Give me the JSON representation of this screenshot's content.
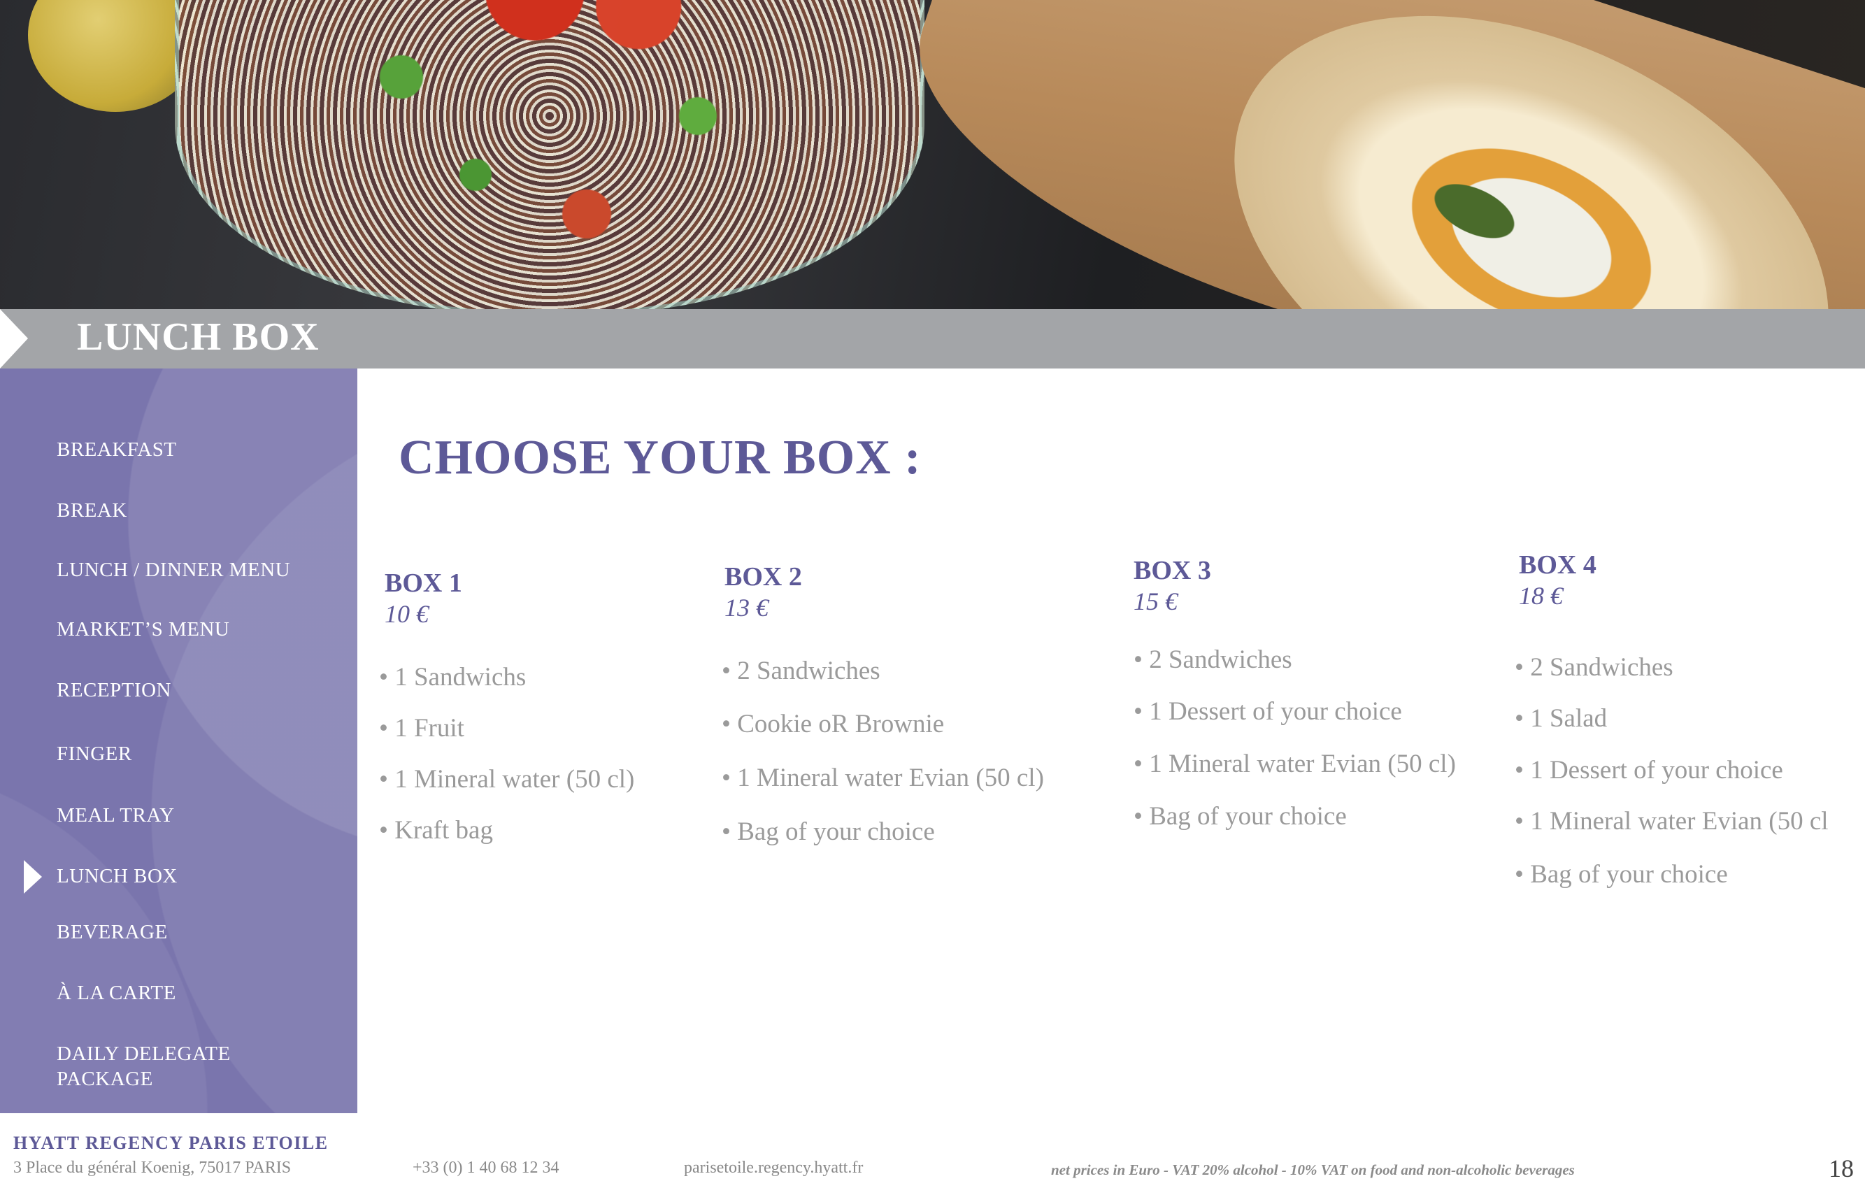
{
  "header": {
    "title": "LUNCH BOX"
  },
  "sidebar": {
    "items": [
      {
        "label": "BREAKFAST"
      },
      {
        "label": "BREAK"
      },
      {
        "label": "LUNCH / DINNER MENU"
      },
      {
        "label": "MARKET’S MENU"
      },
      {
        "label": "RECEPTION"
      },
      {
        "label": "FINGER"
      },
      {
        "label": "MEAL TRAY"
      },
      {
        "label": "LUNCH BOX"
      },
      {
        "label": "BEVERAGE"
      },
      {
        "label": "À LA CARTE"
      },
      {
        "label": "DAILY DELEGATE\nPACKAGE"
      }
    ],
    "active_label": "LUNCH BOX"
  },
  "main": {
    "heading": "CHOOSE YOUR BOX :",
    "boxes": [
      {
        "name": "BOX 1",
        "price": "10 €",
        "items": [
          "• 1 Sandwichs",
          "• 1 Fruit",
          "• 1 Mineral water (50 cl)",
          "• Kraft bag"
        ]
      },
      {
        "name": "BOX 2",
        "price": "13 €",
        "items": [
          "• 2 Sandwiches",
          "• Cookie oR Brownie",
          "• 1 Mineral water Evian (50 cl)",
          "• Bag of your choice"
        ]
      },
      {
        "name": "BOX 3",
        "price": "15 €",
        "items": [
          "• 2 Sandwiches",
          "• 1 Dessert of your choice",
          "• 1 Mineral water Evian (50 cl)",
          "• Bag of your choice"
        ]
      },
      {
        "name": "BOX 4",
        "price": "18 €",
        "items": [
          "• 2 Sandwiches",
          "• 1 Salad",
          "• 1 Dessert of your choice",
          "•  1 Mineral water Evian (50 cl",
          "• Bag of your choice"
        ]
      }
    ]
  },
  "footer": {
    "hotel_name": "HYATT REGENCY PARIS ETOILE",
    "address": "3 Place du général Koenig,  75017 PARIS",
    "phone": "+33 (0) 1 40 68 12 34",
    "website": "parisetoile.regency.hyatt.fr",
    "note": "net prices in Euro - VAT 20% alcohol - 10% VAT on food and non-alcoholic beverages",
    "page_number": "18"
  },
  "colors": {
    "accent": "#5d5997",
    "sidebar": "#7a75ad",
    "title_bar": "#a3a5a8",
    "body_text": "#9a9a9a"
  }
}
